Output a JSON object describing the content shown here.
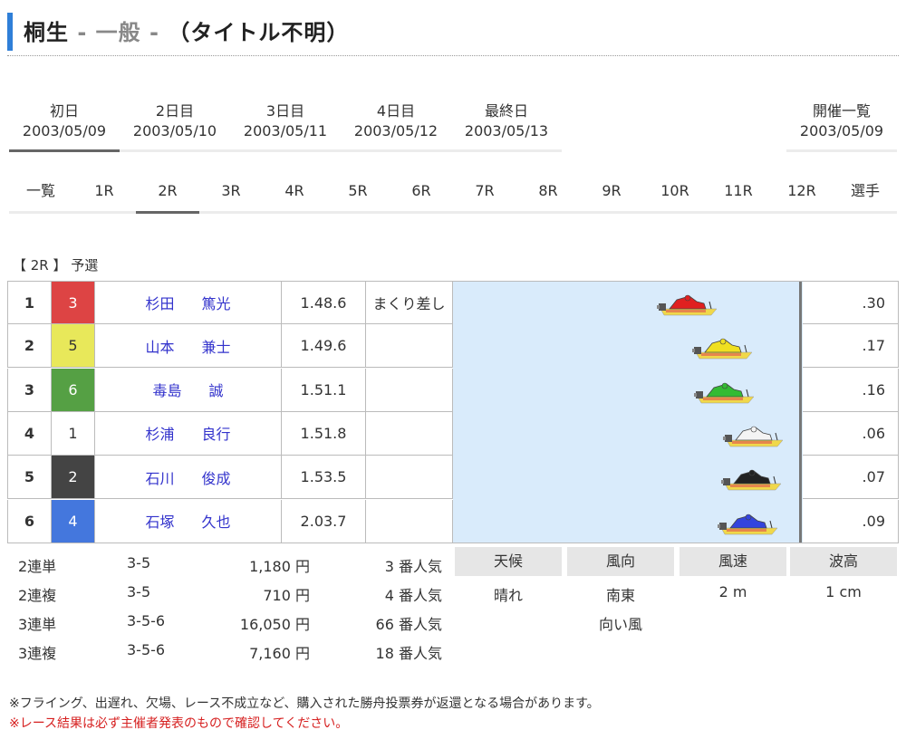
{
  "header": {
    "venue": "桐生",
    "sep1": " - ",
    "grade": "一般",
    "sep2": " - ",
    "race_name": "（タイトル不明）"
  },
  "day_tabs": [
    {
      "label": "初日",
      "date": "2003/05/09",
      "active": true
    },
    {
      "label": "2日目",
      "date": "2003/05/10",
      "active": false
    },
    {
      "label": "3日目",
      "date": "2003/05/11",
      "active": false
    },
    {
      "label": "4日目",
      "date": "2003/05/12",
      "active": false
    },
    {
      "label": "最終日",
      "date": "2003/05/13",
      "active": false
    },
    {
      "label": "開催一覧",
      "date": "2003/05/09",
      "active": false
    }
  ],
  "race_tabs": [
    "一覧",
    "1R",
    "2R",
    "3R",
    "4R",
    "5R",
    "6R",
    "7R",
    "8R",
    "9R",
    "10R",
    "11R",
    "12R",
    "選手"
  ],
  "active_race_tab": "2R",
  "race_label": "【 2R 】 予選",
  "results": [
    {
      "rank": "1",
      "lane": "3",
      "surname": "杉田",
      "given": "篤光",
      "time": "1.48.6",
      "kimarite": "まくり差し",
      "st": ".30"
    },
    {
      "rank": "2",
      "lane": "5",
      "surname": "山本",
      "given": "兼士",
      "time": "1.49.6",
      "kimarite": "",
      "st": ".17"
    },
    {
      "rank": "3",
      "lane": "6",
      "surname": "毒島",
      "given": "誠",
      "time": "1.51.1",
      "kimarite": "",
      "st": ".16"
    },
    {
      "rank": "4",
      "lane": "1",
      "surname": "杉浦",
      "given": "良行",
      "time": "1.51.8",
      "kimarite": "",
      "st": ".06"
    },
    {
      "rank": "5",
      "lane": "2",
      "surname": "石川",
      "given": "俊成",
      "time": "1.53.5",
      "kimarite": "",
      "st": ".07"
    },
    {
      "rank": "6",
      "lane": "4",
      "surname": "石塚",
      "given": "久也",
      "time": "2.03.7",
      "kimarite": "",
      "st": ".09"
    }
  ],
  "lane_colors": {
    "1": "#ffffff",
    "2": "#444444",
    "3": "#dd4444",
    "4": "#4477dd",
    "5": "#e8e85a",
    "6": "#55a044"
  },
  "payouts": [
    {
      "type": "2連単",
      "combo": "3-5",
      "amount": "1,180 円",
      "popularity": "3 番人気"
    },
    {
      "type": "2連複",
      "combo": "3-5",
      "amount": "710 円",
      "popularity": "4 番人気"
    },
    {
      "type": "3連単",
      "combo": "3-5-6",
      "amount": "16,050 円",
      "popularity": "66 番人気"
    },
    {
      "type": "3連複",
      "combo": "3-5-6",
      "amount": "7,160 円",
      "popularity": "18 番人気"
    }
  ],
  "weather": {
    "headers": [
      "天候",
      "風向",
      "風速",
      "波高"
    ],
    "values": [
      "晴れ",
      "南東",
      "2 m",
      "1 cm"
    ],
    "wind_relation": "向い風"
  },
  "notes": {
    "note1": "※フライング、出遅れ、欠場、レース不成立など、購入された勝舟投票券が返還となる場合があります。",
    "note2": "※レース結果は必ず主催者発表のもので確認してください。"
  }
}
